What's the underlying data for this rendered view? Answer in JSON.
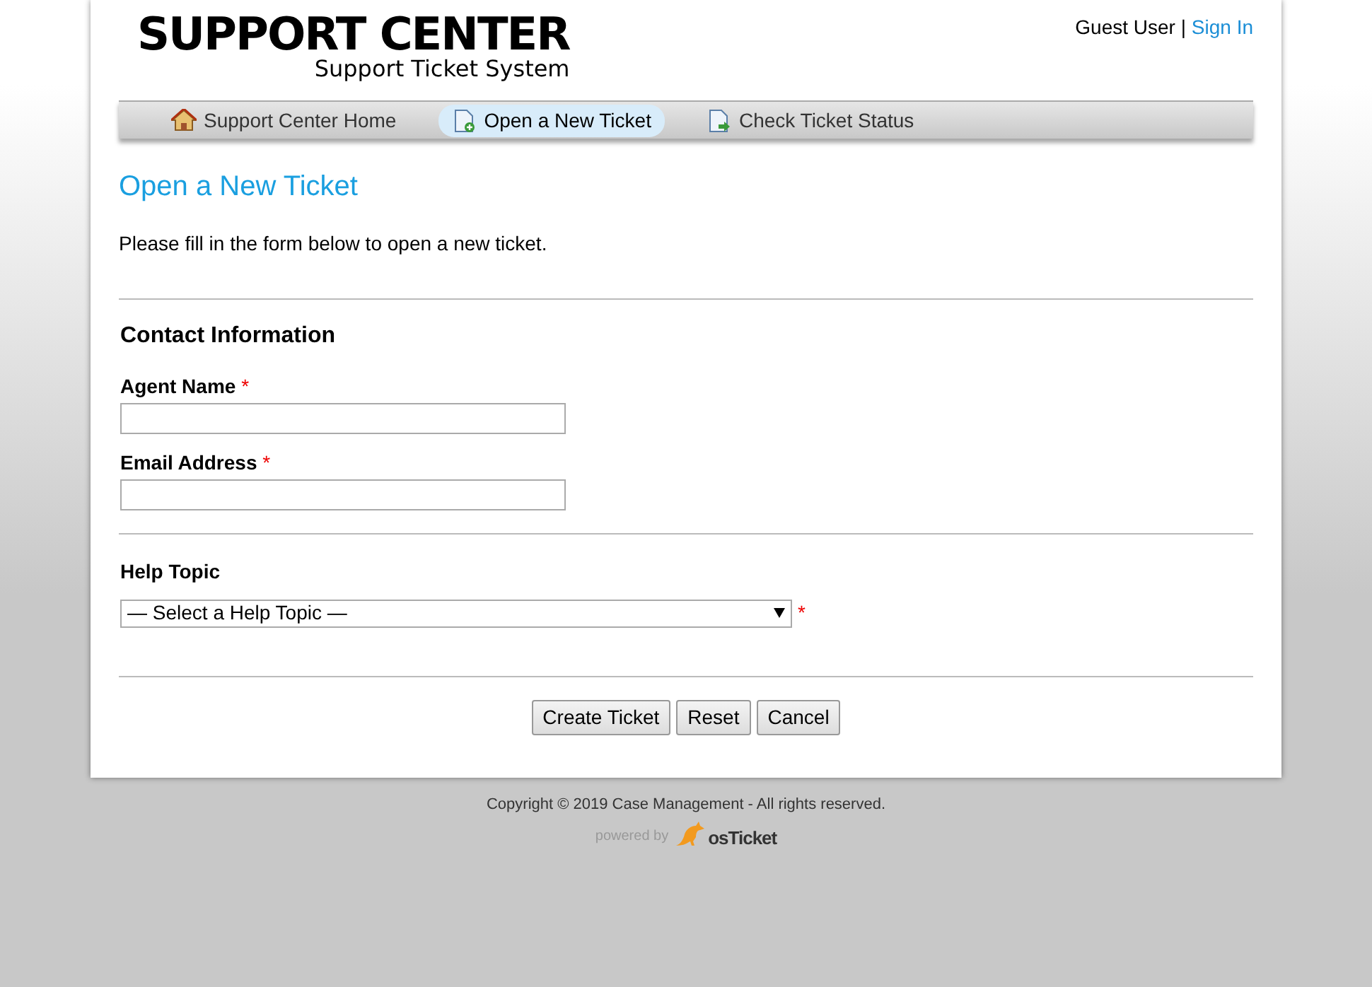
{
  "header": {
    "logo_title": "SUPPORT CENTER",
    "logo_subtitle": "Support Ticket System",
    "user": "Guest User",
    "separator": "|",
    "sign_in": "Sign In"
  },
  "nav": [
    {
      "label": "Support Center Home",
      "kind": "home",
      "selected": false
    },
    {
      "label": "Open a New Ticket",
      "kind": "new",
      "selected": true
    },
    {
      "label": "Check Ticket Status",
      "kind": "status",
      "selected": false
    }
  ],
  "page": {
    "title": "Open a New Ticket",
    "intro": "Please fill in the form below to open a new ticket."
  },
  "contact": {
    "heading": "Contact Information",
    "fields": [
      {
        "label": "Agent Name",
        "required_mark": "*"
      },
      {
        "label": "Email Address",
        "required_mark": "*"
      }
    ]
  },
  "help_topic": {
    "label": "Help Topic",
    "value": "— Select a Help Topic —",
    "required_mark": "*"
  },
  "buttons": [
    "Create Ticket",
    "Reset",
    "Cancel"
  ],
  "footer": {
    "copyright": "Copyright © 2019 Case Management - All rights reserved.",
    "powered_by": "powered by",
    "brand_os": "os",
    "brand_ticket": "Ticket"
  }
}
